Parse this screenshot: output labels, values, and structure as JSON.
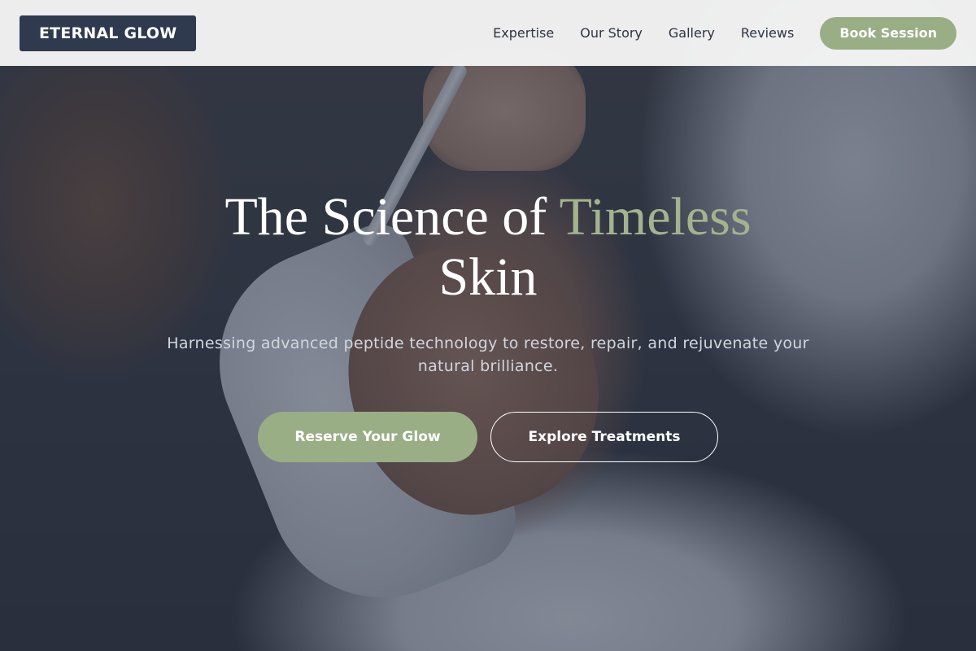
{
  "header": {
    "logo_text": "ETERNAL GLOW",
    "nav": [
      {
        "label": "Expertise"
      },
      {
        "label": "Our Story"
      },
      {
        "label": "Gallery"
      },
      {
        "label": "Reviews"
      }
    ],
    "cta_label": "Book Session"
  },
  "hero": {
    "title_main": "The Science of ",
    "title_accent": "Timeless",
    "title_end": "Skin",
    "subtitle": "Harnessing advanced peptide technology to restore, repair, and rejuvenate your natural brilliance.",
    "primary_cta": "Reserve Your Glow",
    "secondary_cta": "Explore Treatments"
  },
  "colors": {
    "brand_dark": "#2f3a4f",
    "accent_sage": "#9aae86",
    "overlay": "#2d374b"
  }
}
